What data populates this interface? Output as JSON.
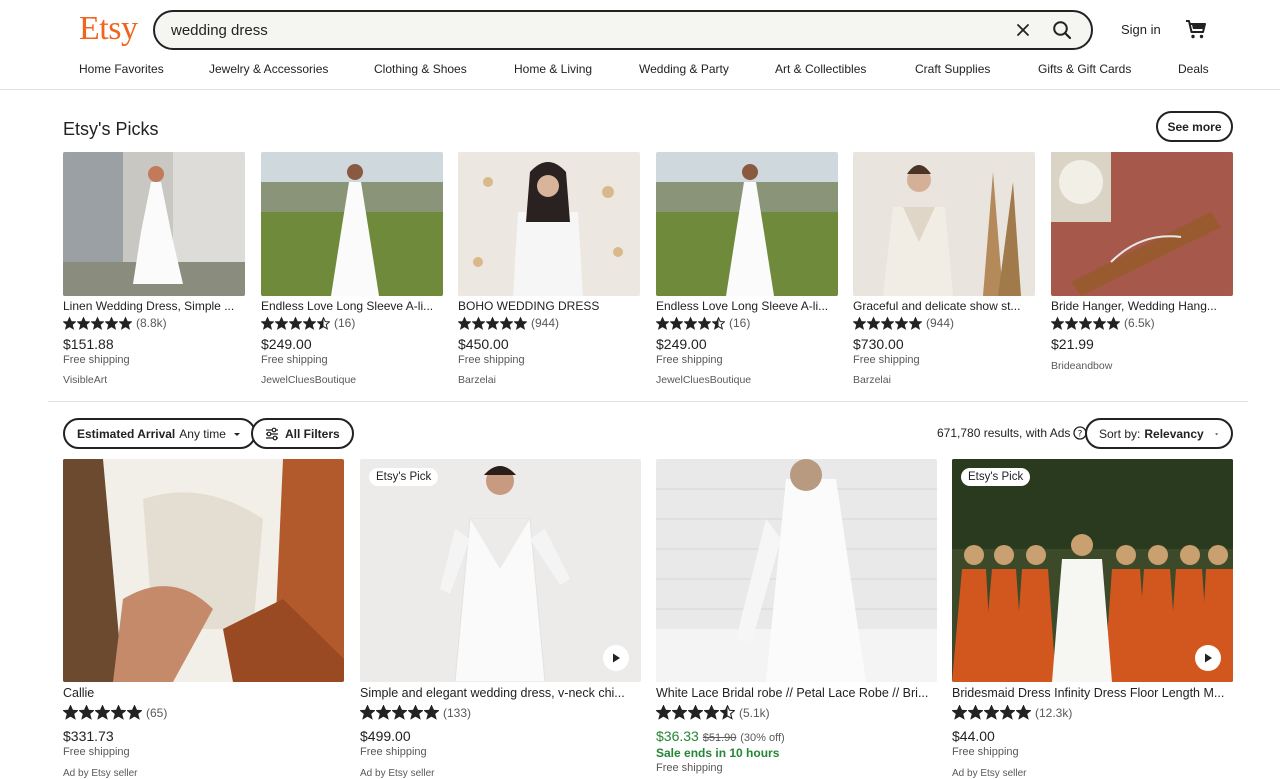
{
  "header": {
    "logo": "Etsy",
    "search_value": "wedding dress",
    "sign_in": "Sign in"
  },
  "nav": [
    "Home Favorites",
    "Jewelry & Accessories",
    "Clothing & Shoes",
    "Home & Living",
    "Wedding & Party",
    "Art & Collectibles",
    "Craft Supplies",
    "Gifts & Gift Cards",
    "Deals"
  ],
  "picks": {
    "title": "Etsy's Picks",
    "see_more": "See more",
    "items": [
      {
        "title": "Linen Wedding Dress, Simple ...",
        "rating": 5,
        "count": "(8.8k)",
        "price": "$151.88",
        "shipping": "Free shipping",
        "shop": "VisibleArt"
      },
      {
        "title": "Endless Love Long Sleeve A-li...",
        "rating": 4.5,
        "count": "(16)",
        "price": "$249.00",
        "shipping": "Free shipping",
        "shop": "JewelCluesBoutique"
      },
      {
        "title": "BOHO WEDDING DRESS",
        "rating": 5,
        "count": "(944)",
        "price": "$450.00",
        "shipping": "Free shipping",
        "shop": "Barzelai"
      },
      {
        "title": "Endless Love Long Sleeve A-li...",
        "rating": 4.5,
        "count": "(16)",
        "price": "$249.00",
        "shipping": "Free shipping",
        "shop": "JewelCluesBoutique"
      },
      {
        "title": "Graceful and delicate show st...",
        "rating": 5,
        "count": "(944)",
        "price": "$730.00",
        "shipping": "Free shipping",
        "shop": "Barzelai"
      },
      {
        "title": "Bride Hanger, Wedding Hang...",
        "rating": 5,
        "count": "(6.5k)",
        "price": "$21.99",
        "shipping": "",
        "shop": "Brideandbow"
      }
    ]
  },
  "filters": {
    "arrival_label": "Estimated Arrival",
    "arrival_value": "Any time",
    "all_filters": "All Filters",
    "results_text": "671,780 results, with Ads",
    "sort_label": "Sort by:",
    "sort_value": "Relevancy"
  },
  "results": [
    {
      "title": "Callie",
      "rating": 5,
      "count": "(65)",
      "price": "$331.73",
      "shipping": "Free shipping",
      "badge": "",
      "video": false,
      "ad": "Ad by Etsy seller"
    },
    {
      "title": "Simple and elegant wedding dress, v-neck chi...",
      "rating": 5,
      "count": "(133)",
      "price": "$499.00",
      "shipping": "Free shipping",
      "badge": "Etsy's Pick",
      "video": true,
      "ad": "Ad by Etsy seller"
    },
    {
      "title": "White Lace Bridal robe // Petal Lace Robe // Bri...",
      "rating": 4.5,
      "count": "(5.1k)",
      "price": "$36.33",
      "original_price": "$51.90",
      "discount": "(30% off)",
      "sale_text": "Sale ends in 10 hours",
      "shipping": "Free shipping",
      "badge": "",
      "video": false,
      "ad": ""
    },
    {
      "title": "Bridesmaid Dress Infinity Dress Floor Length M...",
      "rating": 5,
      "count": "(12.3k)",
      "price": "$44.00",
      "shipping": "Free shipping",
      "badge": "Etsy's Pick",
      "video": true,
      "ad": "Ad by Etsy seller"
    }
  ],
  "colors": {
    "brand": "#f1641e",
    "sale": "#258635",
    "text": "#222222",
    "muted": "#595959"
  }
}
